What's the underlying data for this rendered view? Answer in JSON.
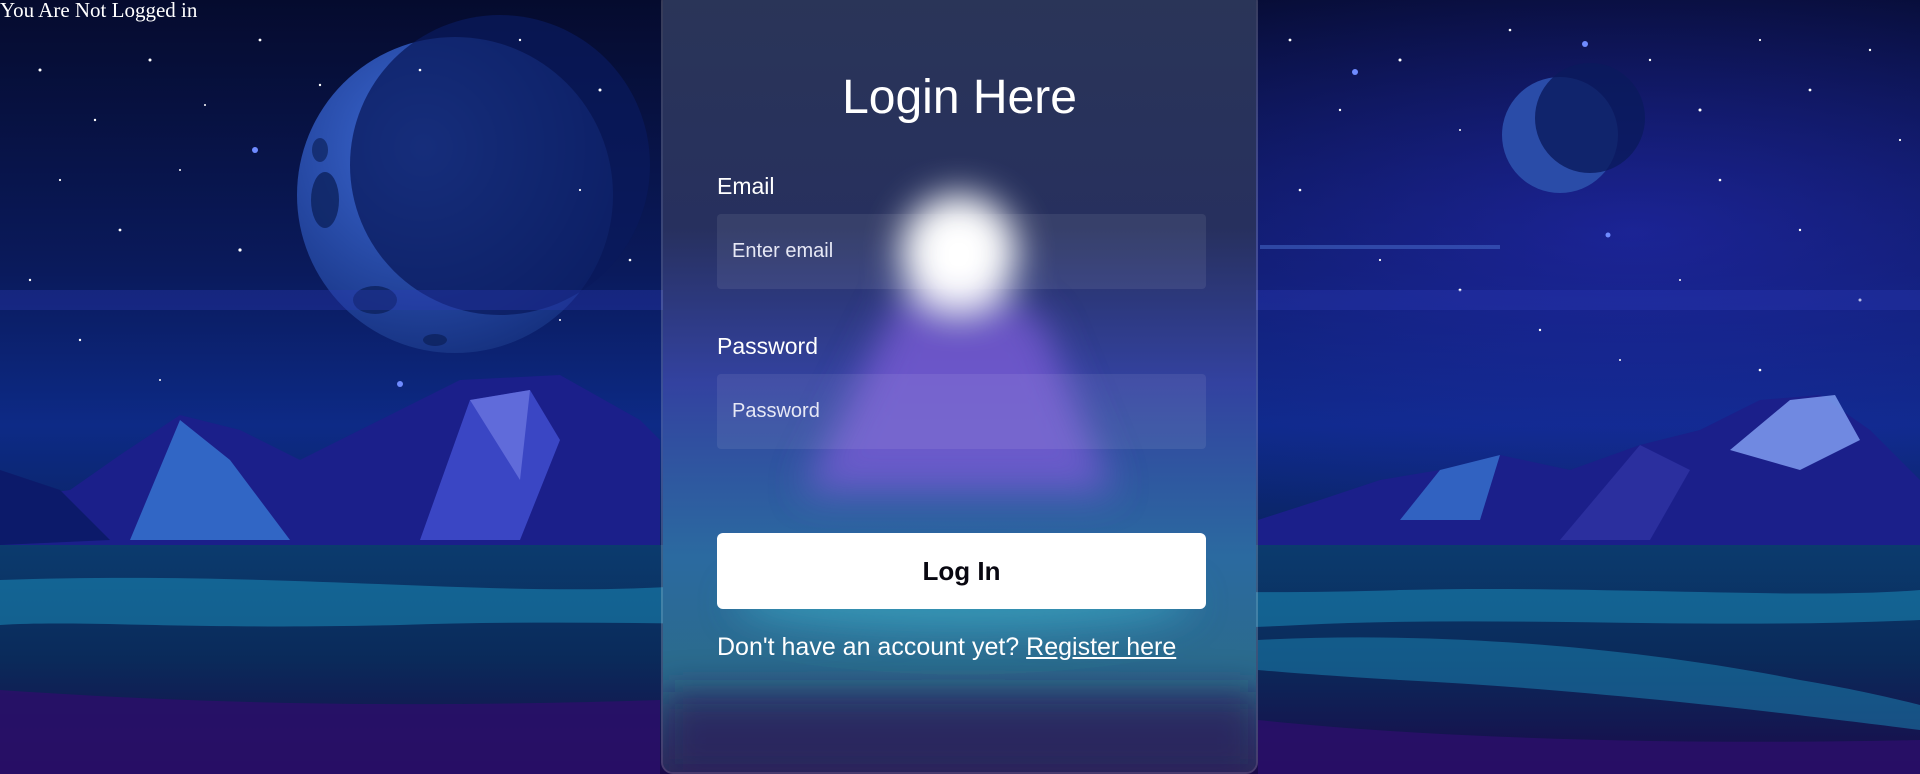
{
  "status": {
    "text": "You Are Not Logged in"
  },
  "login_form": {
    "title": "Login Here",
    "email_label": "Email",
    "email_placeholder": "Enter email",
    "email_value": "",
    "password_label": "Password",
    "password_placeholder": "Password",
    "password_value": "",
    "submit_label": "Log In",
    "register_prompt": "Don't have an account yet?",
    "register_link": "Register here"
  },
  "colors": {
    "sky": "#020a2e",
    "mountain": "#2b2f9e",
    "water": "#1d7fa8",
    "card_surface": "#ffffff",
    "button_text": "#080710"
  },
  "background": {
    "scene": "night-sky-mountains-lake",
    "icons": [
      "moon-icon",
      "small-moon-icon",
      "stars",
      "mountains",
      "lake"
    ]
  }
}
